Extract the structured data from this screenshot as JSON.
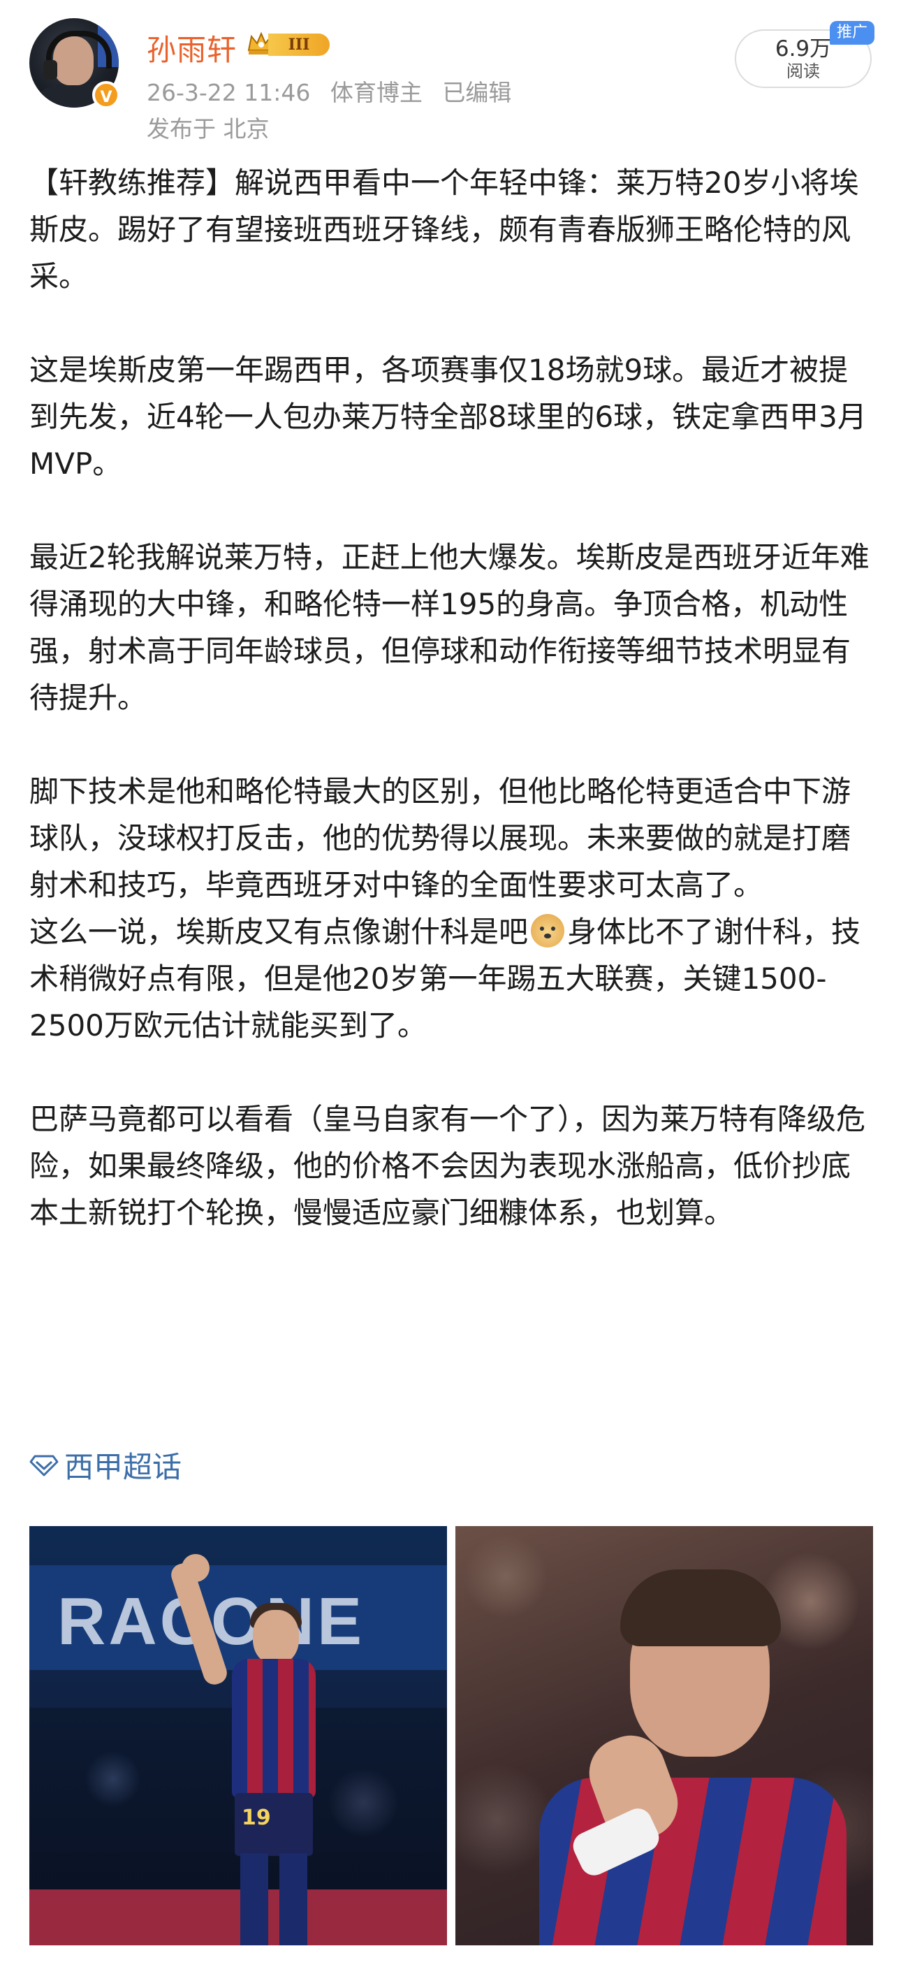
{
  "user": {
    "name": "孙雨轩",
    "level": "III",
    "verified_badge": "V"
  },
  "post_meta": {
    "date": "26-3-22 11:46",
    "role": "体育博主",
    "edited": "已编辑",
    "location": "发布于 北京"
  },
  "stats": {
    "read_count": "6.9万",
    "read_label": "阅读",
    "promo_tag": "推广"
  },
  "content": {
    "p1": "【轩教练推荐】解说西甲看中一个年轻中锋：莱万特20岁小将埃斯皮。踢好了有望接班西班牙锋线，颇有青春版狮王略伦特的风采。",
    "p2": "这是埃斯皮第一年踢西甲，各项赛事仅18场就9球。最近才被提到先发，近4轮一人包办莱万特全部8球里的6球，铁定拿西甲3月MVP。",
    "p3": "最近2轮我解说莱万特，正赶上他大爆发。埃斯皮是西班牙近年难得涌现的大中锋，和略伦特一样195的身高。争顶合格，机动性强，射术高于同年龄球员，但停球和动作衔接等细节技术明显有待提升。",
    "p4": "脚下技术是他和略伦特最大的区别，但他比略伦特更适合中下游球队，没球权打反击，他的优势得以展现。未来要做的就是打磨射术和技巧，毕竟西班牙对中锋的全面性要求可太高了。",
    "p5_before_emoji": "这么一说，埃斯皮又有点像谢什科是吧",
    "p5_after_emoji": "身体比不了谢什科，技术稍微好点有限，但是他20岁第一年踢五大联赛，关键1500-2500万欧元估计就能买到了。",
    "p6": "巴萨马竟都可以看看（皇马自家有一个了），因为莱万特有降级危险，如果最终降级，他的价格不会因为表现水涨船高，低价抄底本土新锐打个轮换，慢慢适应豪门细糠体系，也划算。"
  },
  "topic": {
    "label": "西甲超话"
  },
  "photos": {
    "banner_text": "RACONE",
    "jersey_number": "19"
  },
  "colors": {
    "username": "#e9612b",
    "meta": "#9a9a9a",
    "topic": "#3c6ea8",
    "promo": "#4b8ff1"
  }
}
